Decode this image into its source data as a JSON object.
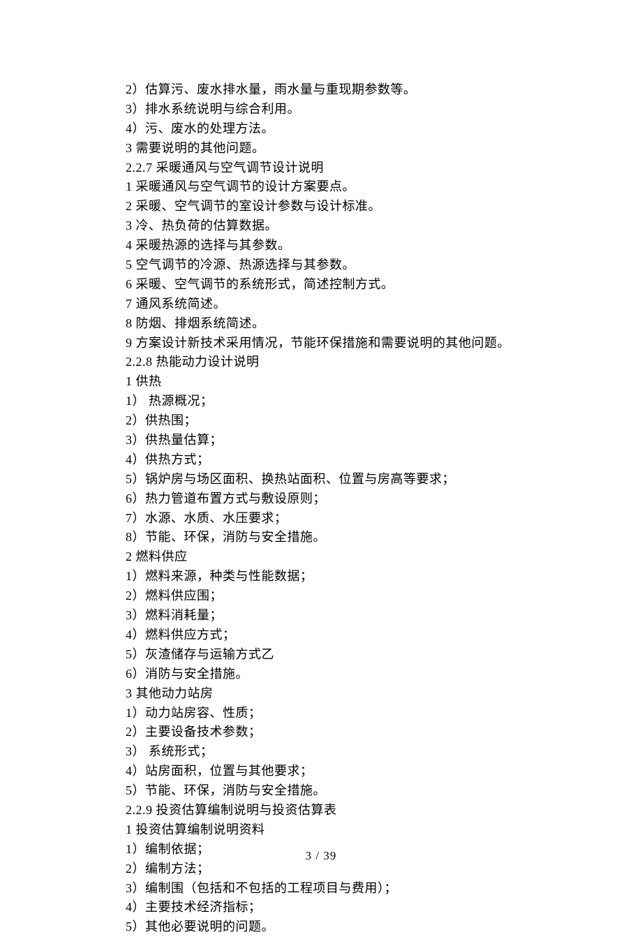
{
  "lines": [
    "2）估算污、废水排水量，雨水量与重现期参数等。",
    "3）排水系统说明与综合利用。",
    "4）污、废水的处理方法。",
    "3 需要说明的其他问题。",
    "2.2.7 采暖通风与空气调节设计说明",
    "1 采暖通风与空气调节的设计方案要点。",
    "2 采暖、空气调节的室设计参数与设计标准。",
    "3 冷、热负荷的估算数据。",
    "4 采暖热源的选择与其参数。",
    "5 空气调节的冷源、热源选择与其参数。",
    "6 采暖、空气调节的系统形式，简述控制方式。",
    "7 通风系统简述。",
    "8 防烟、排烟系统简述。",
    "9 方案设计新技术采用情况，节能环保措施和需要说明的其他问题。",
    "2.2.8 热能动力设计说明",
    "1 供热",
    "1） 热源概况；",
    "2）供热围；",
    "3）供热量估算；",
    "4）供热方式；",
    "5）锅炉房与场区面积、换热站面积、位置与房高等要求；",
    "6）热力管道布置方式与敷设原则；",
    "7）水源、水质、水压要求；",
    "8）节能、环保，消防与安全措施。",
    "2 燃料供应",
    "1）燃料来源，种类与性能数据；",
    "2）燃料供应围；",
    "3）燃料消耗量；",
    "4）燃料供应方式；",
    "5）灰渣储存与运输方式乙",
    "6）消防与安全措施。",
    "3 其他动力站房",
    "1）动力站房容、性质；",
    "2）主要设备技术参数；",
    "3） 系统形式；",
    "4）站房面积，位置与其他要求；",
    "5）节能、环保，消防与安全措施。",
    "2.2.9 投资估算编制说明与投资估算表",
    "1 投资估算编制说明资料",
    "1）编制依据；",
    "2）编制方法；",
    "3）编制围（包括和不包括的工程项目与费用）；",
    "4）主要技术经济指标；",
    "5）其他必要说明的问题。"
  ],
  "page_number": "3 / 39"
}
